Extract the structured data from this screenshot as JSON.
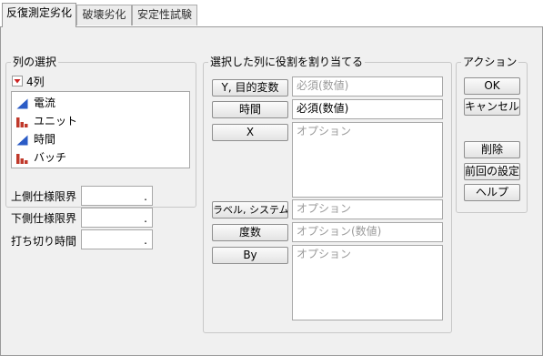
{
  "tabs": [
    {
      "label": "反復測定劣化",
      "active": true
    },
    {
      "label": "破壊劣化",
      "active": false
    },
    {
      "label": "安定性試験",
      "active": false
    }
  ],
  "column_selection": {
    "legend": "列の選択",
    "count_label": "4列",
    "columns": [
      {
        "name": "電流",
        "icon": "continuous-icon"
      },
      {
        "name": "ユニット",
        "icon": "nominal-icon"
      },
      {
        "name": "時間",
        "icon": "continuous-icon"
      },
      {
        "name": "バッチ",
        "icon": "nominal-icon"
      }
    ]
  },
  "spec_fields": {
    "upper_spec": {
      "label": "上側仕様限界",
      "value": "."
    },
    "lower_spec": {
      "label": "下側仕様限界",
      "value": "."
    },
    "censor_time": {
      "label": "打ち切り時間",
      "value": "."
    }
  },
  "role_assignment": {
    "legend": "選択した列に役割を割り当てる",
    "roles": {
      "y": {
        "button": "Y, 目的変数",
        "placeholder": "必須(数値)"
      },
      "time": {
        "button": "時間",
        "placeholder": "必須(数値)"
      },
      "x": {
        "button": "X",
        "placeholder": "オプション"
      },
      "label": {
        "button": "ラベル, システムID",
        "placeholder": "オプション"
      },
      "freq": {
        "button": "度数",
        "placeholder": "オプション(数値)"
      },
      "by": {
        "button": "By",
        "placeholder": "オプション"
      }
    }
  },
  "actions": {
    "legend": "アクション",
    "ok": "OK",
    "cancel": "キャンセル",
    "remove": "削除",
    "recall": "前回の設定",
    "help": "ヘルプ"
  },
  "colors": {
    "continuous": "#2a5bc6",
    "nominal": "#c0392b",
    "dropdown": "#cc2222"
  }
}
